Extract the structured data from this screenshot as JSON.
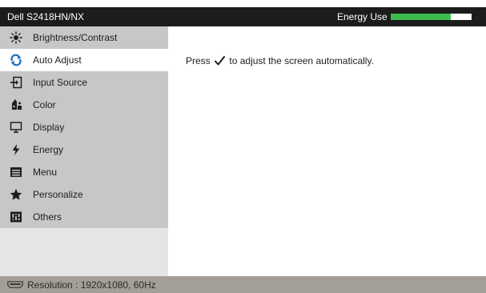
{
  "header": {
    "model": "Dell S2418HN/NX",
    "energy_label": "Energy Use",
    "energy_level_fraction": 0.74,
    "energy_color": "#3dbd4f"
  },
  "menu": {
    "items": [
      {
        "label": "Brightness/Contrast",
        "icon": "brightness-icon"
      },
      {
        "label": "Auto Adjust",
        "icon": "auto-adjust-icon",
        "active": true
      },
      {
        "label": "Input Source",
        "icon": "input-source-icon"
      },
      {
        "label": "Color",
        "icon": "color-icon"
      },
      {
        "label": "Display",
        "icon": "display-icon"
      },
      {
        "label": "Energy",
        "icon": "energy-icon"
      },
      {
        "label": "Menu",
        "icon": "menu-icon"
      },
      {
        "label": "Personalize",
        "icon": "personalize-icon"
      },
      {
        "label": "Others",
        "icon": "others-icon"
      }
    ]
  },
  "content": {
    "instruction_before": "Press",
    "instruction_after": "to adjust the screen automatically.",
    "check_icon": "checkmark-icon"
  },
  "footer": {
    "resolution_text": "Resolution : 1920x1080, 60Hz",
    "icon": "hdmi-connector-icon"
  },
  "colors": {
    "header_bg": "#1c1c1c",
    "sidebar_item_bg": "#c7c7c7",
    "active_item_bg": "#ffffff",
    "footer_bg": "#a39f96",
    "accent": "#1f6fbf"
  }
}
